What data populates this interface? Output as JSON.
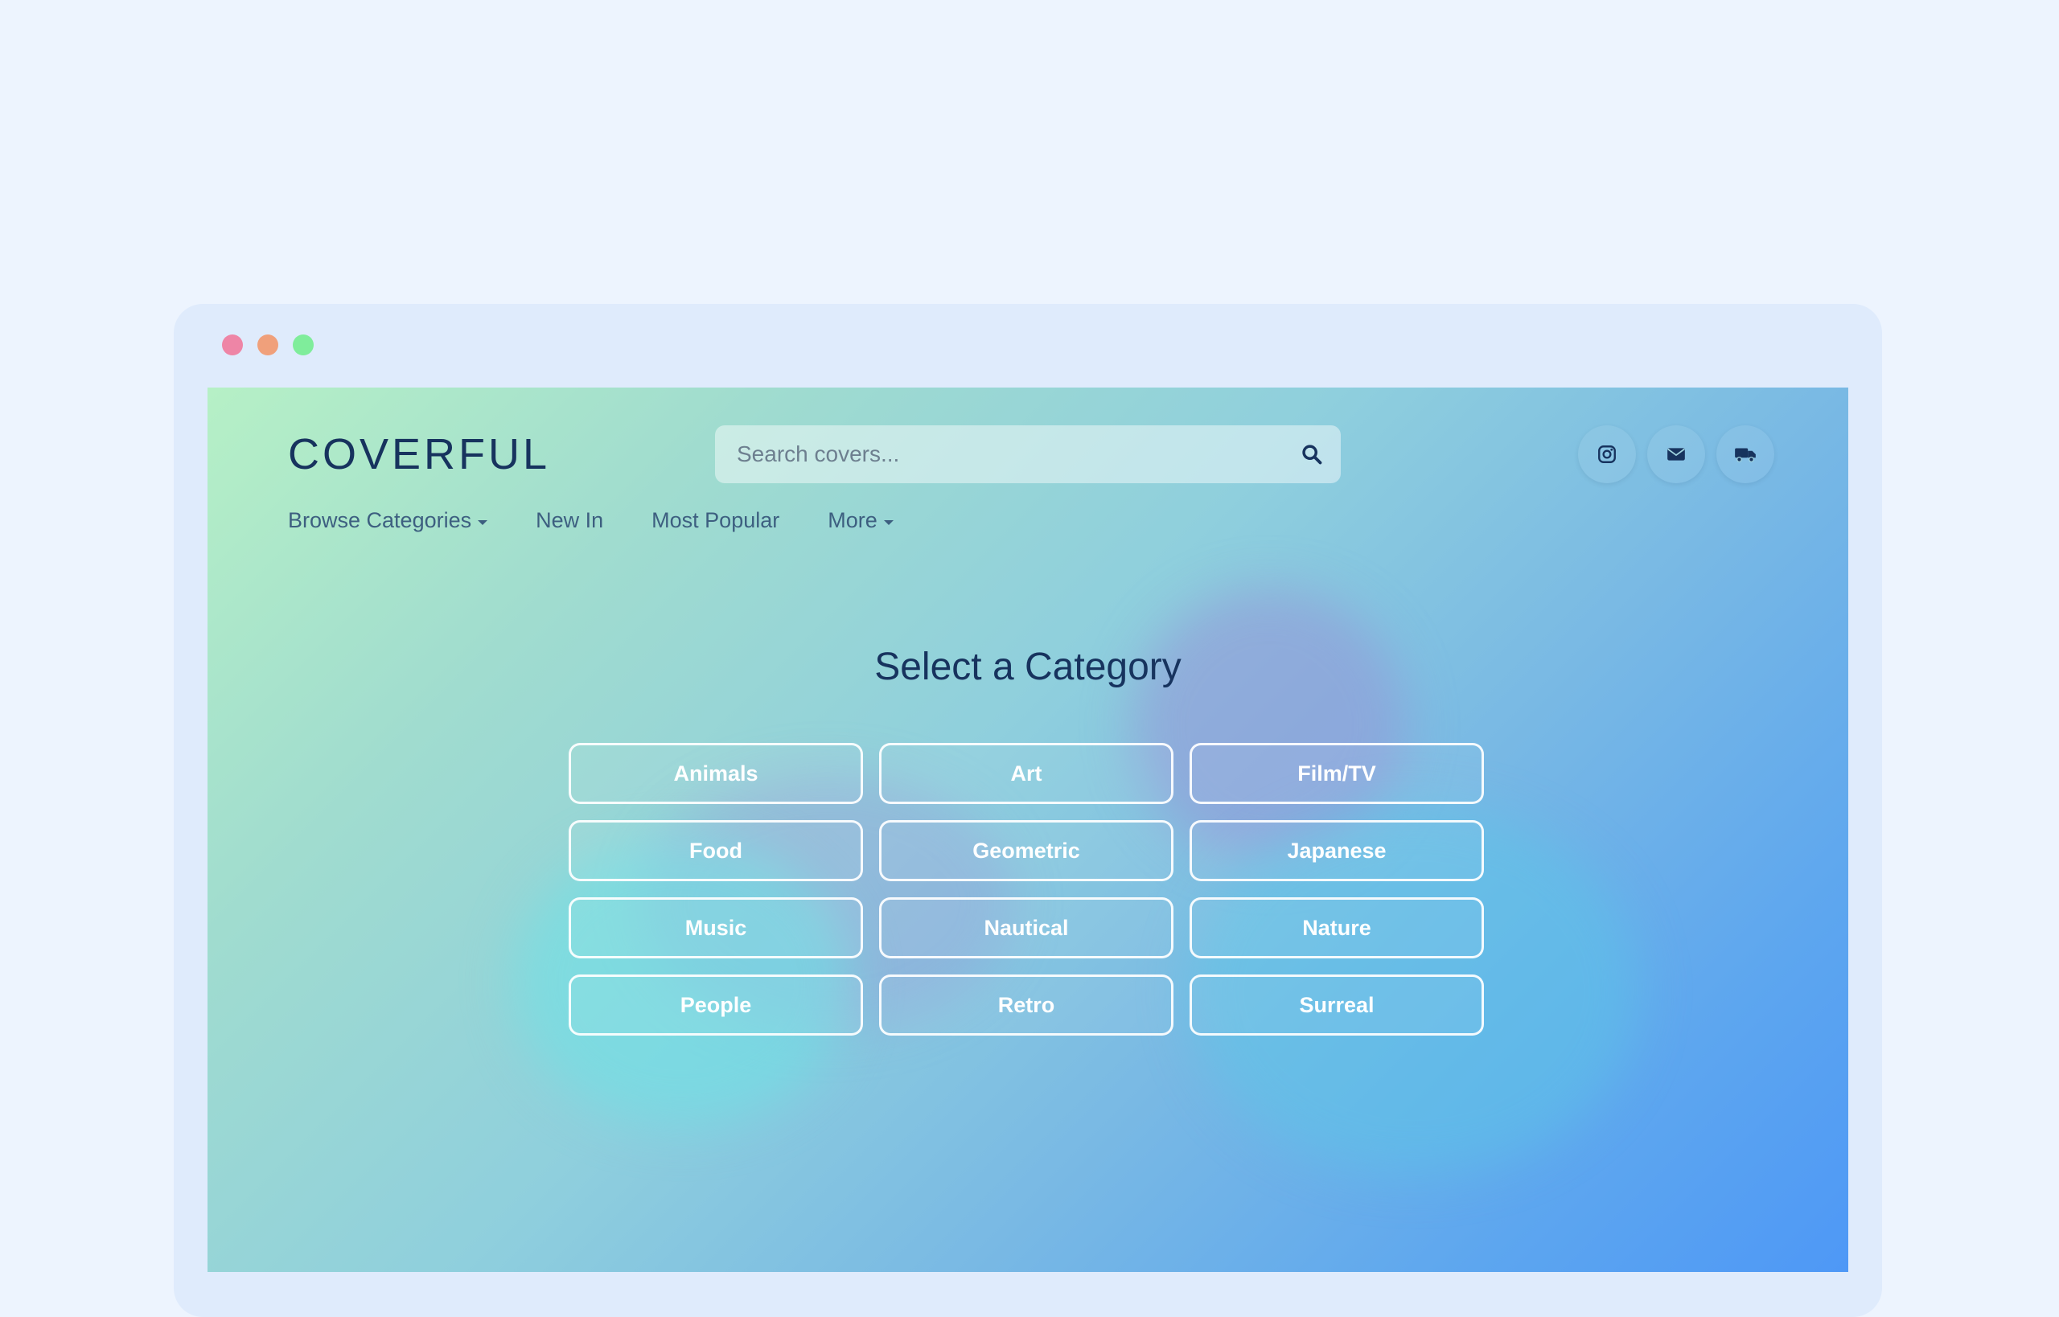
{
  "window": {
    "controls": [
      "close",
      "minimize",
      "maximize"
    ]
  },
  "header": {
    "logo": "COVERFUL",
    "search": {
      "placeholder": "Search covers...",
      "value": ""
    },
    "social_icons": [
      "instagram-icon",
      "mail-icon",
      "truck-icon"
    ]
  },
  "nav": {
    "items": [
      {
        "label": "Browse Categories",
        "dropdown": true
      },
      {
        "label": "New In",
        "dropdown": false
      },
      {
        "label": "Most Popular",
        "dropdown": false
      },
      {
        "label": "More",
        "dropdown": true
      }
    ]
  },
  "main": {
    "heading": "Select a Category",
    "categories": [
      "Animals",
      "Art",
      "Film/TV",
      "Food",
      "Geometric",
      "Japanese",
      "Music",
      "Nautical",
      "Nature",
      "People",
      "Retro",
      "Surreal"
    ]
  },
  "colors": {
    "brand_text": "#17335e",
    "nav_text": "#3d5f80",
    "gradient_start": "#b6f0c6",
    "gradient_end": "#4e98f6",
    "dot_red": "#ee85a6",
    "dot_orange": "#f0a07b",
    "dot_green": "#7fed9b"
  }
}
